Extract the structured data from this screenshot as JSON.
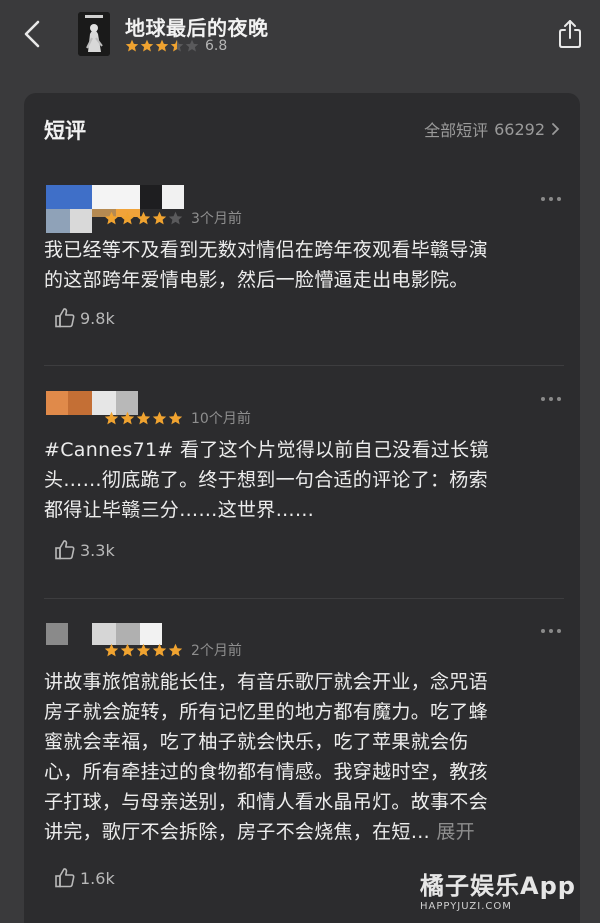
{
  "header": {
    "title": "地球最后的夜晚",
    "rating": "6.8",
    "rating_stars": 3.5,
    "back_icon": "chevron-left-icon",
    "share_icon": "share-icon"
  },
  "section": {
    "title": "短评",
    "all_label": "全部短评",
    "count": "66292"
  },
  "reviews": [
    {
      "stars": 4,
      "time": "3个月前",
      "lines": [
        "我已经等不及看到无数对情侣在跨年夜观看毕赣导演",
        "的这部跨年爱情电影，然后一脸懵逼走出电影院。"
      ],
      "likes": "9.8k"
    },
    {
      "stars": 5,
      "time": "10个月前",
      "lines": [
        "#Cannes71# 看了这个片觉得以前自己没看过长镜",
        "头……彻底跪了。终于想到一句合适的评论了：杨索",
        "都得让毕赣三分……这世界……"
      ],
      "likes": "3.3k"
    },
    {
      "stars": 5,
      "time": "2个月前",
      "lines": [
        "讲故事旅馆就能长住，有音乐歌厅就会开业，念咒语",
        "房子就会旋转，所有记忆里的地方都有魔力。吃了蜂",
        "蜜就会幸福，吃了柚子就会快乐，吃了苹果就会伤",
        "心，所有牵挂过的食物都有情感。我穿越时空，教孩",
        "子打球，与母亲送别，和情人看水晶吊灯。故事不会",
        "讲完，歌厅不会拆除，房子不会烧焦，在短…"
      ],
      "expand": "展开",
      "likes": "1.6k"
    }
  ],
  "watermark": {
    "main": "橘子娱乐App",
    "sub": "HAPPYJUZI.COM"
  },
  "colors": {
    "star_on": "#f0a330",
    "star_off": "#5a5a5c",
    "background": "#3a3a3c",
    "card": "#2c2c2e"
  }
}
